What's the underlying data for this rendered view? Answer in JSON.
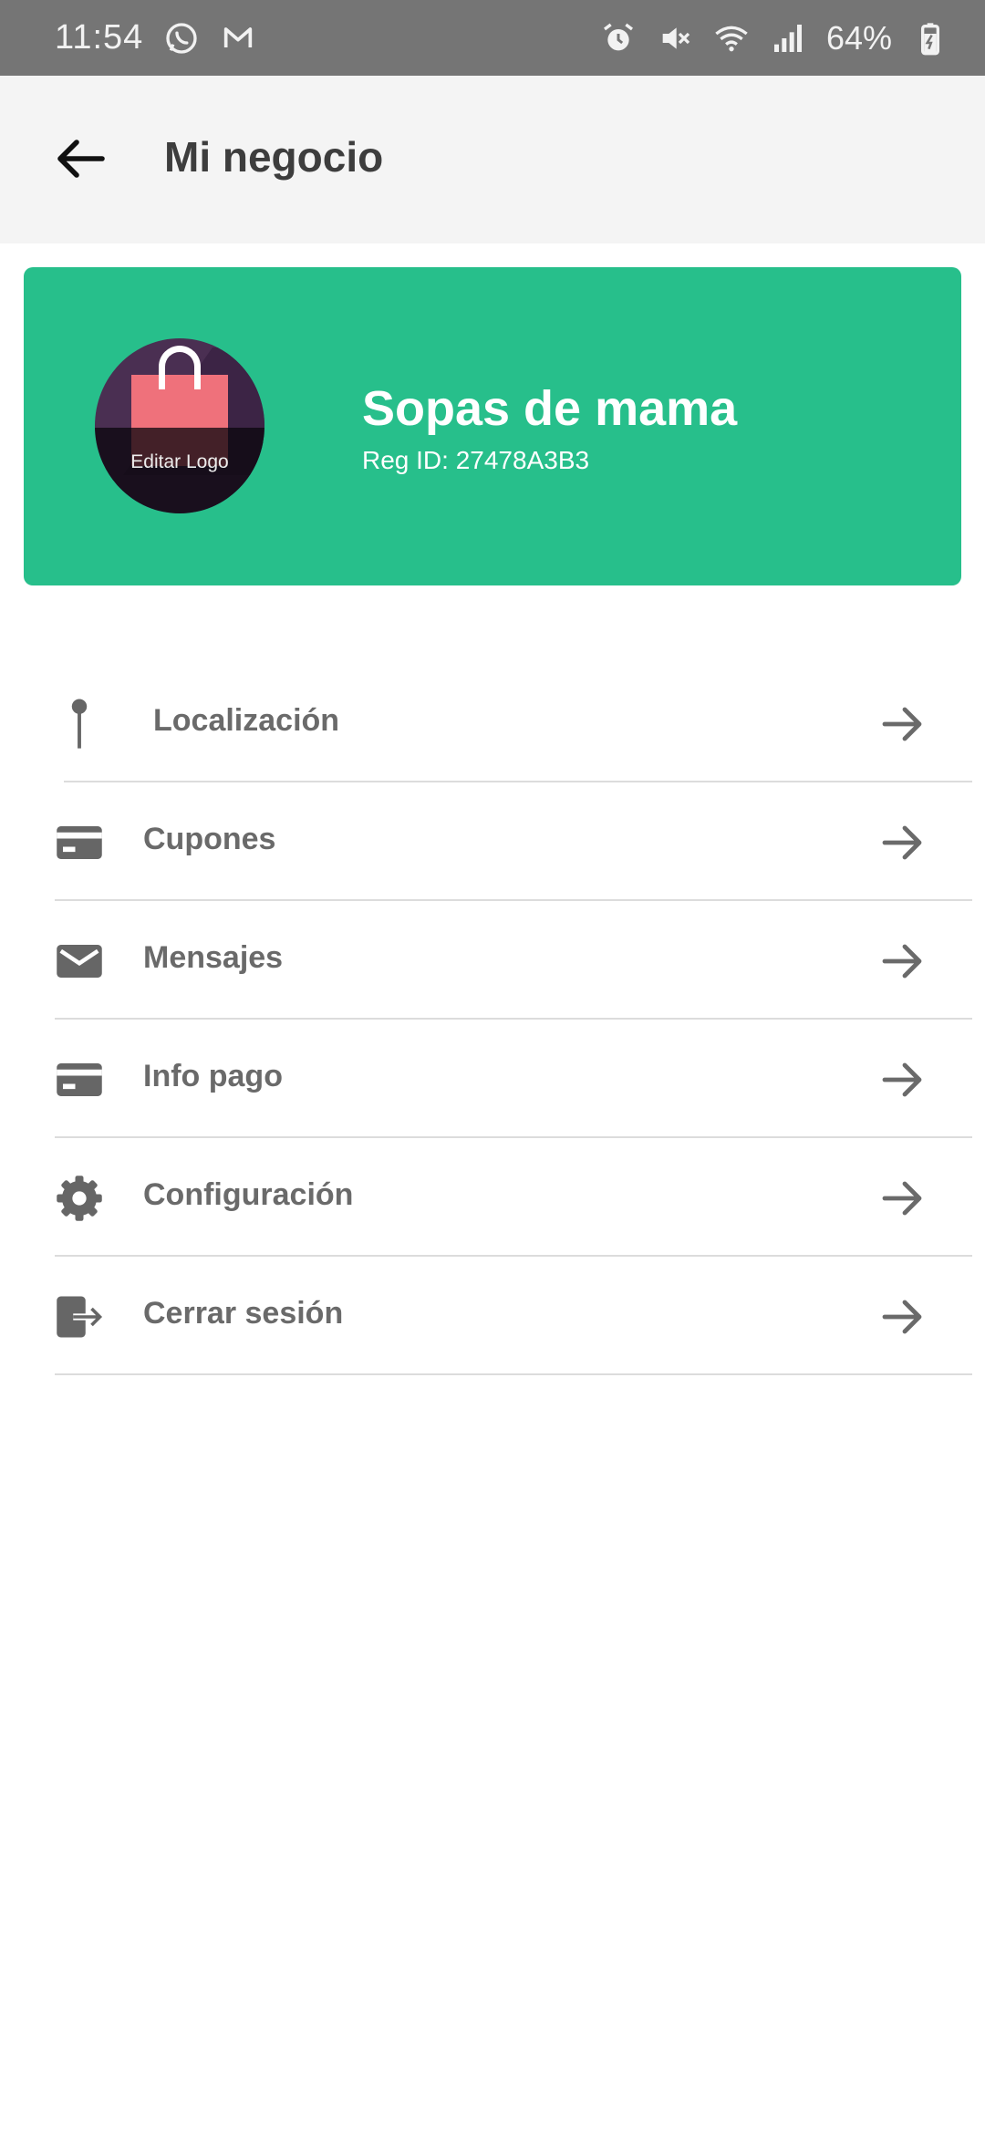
{
  "status_bar": {
    "time": "11:54",
    "battery": "64%",
    "icons": [
      "whatsapp-icon",
      "gmail-icon",
      "alarm-icon",
      "mute-icon",
      "wifi-icon",
      "signal-icon",
      "battery-charging-icon"
    ]
  },
  "app_bar": {
    "title": "Mi negocio",
    "back_icon": "arrow-back-icon"
  },
  "business": {
    "name": "Sopas de mama",
    "reg_id": "Reg ID: 27478A3B3",
    "logo_label": "Editar Logo",
    "card_color": "#27bf8b"
  },
  "menu": {
    "items": [
      {
        "label": "Localización",
        "icon": "pin-icon"
      },
      {
        "label": "Cupones",
        "icon": "card-icon"
      },
      {
        "label": "Mensajes",
        "icon": "mail-icon"
      },
      {
        "label": "Info pago",
        "icon": "card-icon"
      },
      {
        "label": "Configuración",
        "icon": "gear-icon"
      },
      {
        "label": "Cerrar sesión",
        "icon": "logout-icon"
      }
    ],
    "arrow_icon": "arrow-forward-icon"
  },
  "colors": {
    "status_bar": "#757575",
    "app_bar": "#f4f4f4",
    "accent": "#27bf8b",
    "menu_text": "#6a6a6a"
  }
}
